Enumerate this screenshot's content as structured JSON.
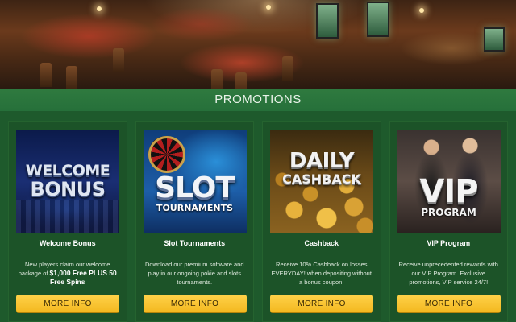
{
  "header": {
    "title": "PROMOTIONS"
  },
  "cards": [
    {
      "image_line1": "WELCOME",
      "image_line2": "BONUS",
      "title": "Welcome Bonus",
      "desc_pre": "New players claim our welcome package of ",
      "desc_bold": "$1,000 Free PLUS 50 Free Spins",
      "button": "MORE INFO"
    },
    {
      "image_line1": "SLOT",
      "image_line2": "TOURNAMENTS",
      "title": "Slot Tournaments",
      "desc": "Download our premium software and play in our ongoing pokie and slots tournaments.",
      "button": "MORE INFO"
    },
    {
      "image_line1": "DAILY",
      "image_line2": "CASHBACK",
      "title": "Cashback",
      "desc": "Receive 10% Cashback on losses EVERYDAY! when depositing without a bonus coupon!",
      "button": "MORE INFO"
    },
    {
      "image_line1": "VIP",
      "image_line2": "PROGRAM",
      "title": "VIP Program",
      "desc": "Receive unprecedented rewards with our VIP Program. Exclusive promotions, VIP service 24/7!",
      "button": "MORE INFO"
    }
  ],
  "colors": {
    "background": "#1e5a2c",
    "band": "#2f7a3f",
    "button": "#f3b81f"
  }
}
